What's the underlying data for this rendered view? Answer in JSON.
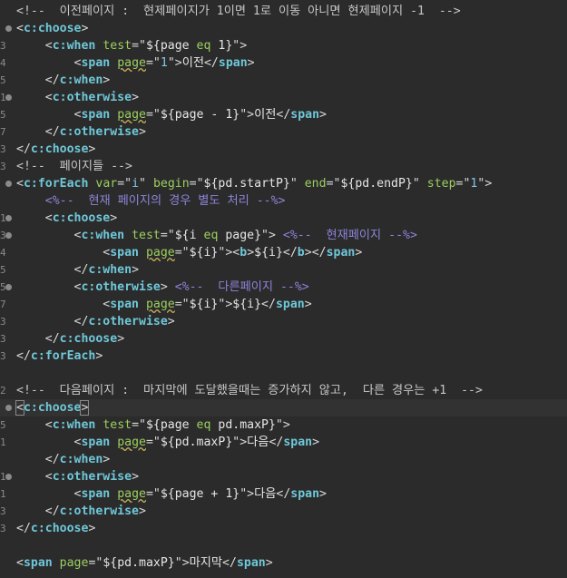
{
  "editor": {
    "lines": [
      {
        "n": "",
        "fold": false,
        "tokens": [
          {
            "c": "cmt",
            "t": "<!--  이전페이지 :  현제페이지가 1이면 1로 이동 아니면 현제페이지 -1  -->"
          }
        ]
      },
      {
        "n": "",
        "fold": true,
        "tokens": [
          {
            "c": "pun",
            "t": "<"
          },
          {
            "c": "tag",
            "t": "c:choose"
          },
          {
            "c": "pun",
            "t": ">"
          }
        ]
      },
      {
        "n": "3",
        "fold": false,
        "tokens": [
          {
            "c": "txt",
            "t": "    "
          },
          {
            "c": "pun",
            "t": "<"
          },
          {
            "c": "tag",
            "t": "c:when"
          },
          {
            "c": "txt",
            "t": " "
          },
          {
            "c": "attr",
            "t": "test"
          },
          {
            "c": "eq",
            "t": "=\""
          },
          {
            "c": "txt",
            "t": "${page "
          },
          {
            "c": "attr",
            "t": "eq"
          },
          {
            "c": "txt",
            "t": " 1}"
          },
          {
            "c": "eq",
            "t": "\""
          },
          {
            "c": "pun",
            "t": ">"
          }
        ]
      },
      {
        "n": "4",
        "fold": false,
        "tokens": [
          {
            "c": "txt",
            "t": "        "
          },
          {
            "c": "pun",
            "t": "<"
          },
          {
            "c": "tag",
            "t": "span"
          },
          {
            "c": "txt",
            "t": " "
          },
          {
            "c": "attr ul",
            "t": "page"
          },
          {
            "c": "eq",
            "t": "=\""
          },
          {
            "c": "str",
            "t": "1"
          },
          {
            "c": "eq",
            "t": "\""
          },
          {
            "c": "pun",
            "t": ">"
          },
          {
            "c": "txt",
            "t": "이전"
          },
          {
            "c": "pun",
            "t": "</"
          },
          {
            "c": "tag",
            "t": "span"
          },
          {
            "c": "pun",
            "t": ">"
          }
        ]
      },
      {
        "n": "5",
        "fold": false,
        "tokens": [
          {
            "c": "txt",
            "t": "    "
          },
          {
            "c": "pun",
            "t": "</"
          },
          {
            "c": "tag",
            "t": "c:when"
          },
          {
            "c": "pun",
            "t": ">"
          }
        ]
      },
      {
        "n": "1",
        "fold": true,
        "tokens": [
          {
            "c": "txt",
            "t": "    "
          },
          {
            "c": "pun",
            "t": "<"
          },
          {
            "c": "tag",
            "t": "c:otherwise"
          },
          {
            "c": "pun",
            "t": ">"
          }
        ]
      },
      {
        "n": "5",
        "fold": false,
        "tokens": [
          {
            "c": "txt",
            "t": "        "
          },
          {
            "c": "pun",
            "t": "<"
          },
          {
            "c": "tag",
            "t": "span"
          },
          {
            "c": "txt",
            "t": " "
          },
          {
            "c": "attr ul",
            "t": "page"
          },
          {
            "c": "eq",
            "t": "=\""
          },
          {
            "c": "txt",
            "t": "${page - 1}"
          },
          {
            "c": "eq",
            "t": "\""
          },
          {
            "c": "pun",
            "t": ">"
          },
          {
            "c": "txt",
            "t": "이전"
          },
          {
            "c": "pun",
            "t": "</"
          },
          {
            "c": "tag",
            "t": "span"
          },
          {
            "c": "pun",
            "t": ">"
          }
        ]
      },
      {
        "n": "7",
        "fold": false,
        "tokens": [
          {
            "c": "txt",
            "t": "    "
          },
          {
            "c": "pun",
            "t": "</"
          },
          {
            "c": "tag",
            "t": "c:otherwise"
          },
          {
            "c": "pun",
            "t": ">"
          }
        ]
      },
      {
        "n": "3",
        "fold": false,
        "tokens": [
          {
            "c": "pun",
            "t": "</"
          },
          {
            "c": "tag",
            "t": "c:choose"
          },
          {
            "c": "pun",
            "t": ">"
          }
        ]
      },
      {
        "n": "3",
        "fold": false,
        "tokens": [
          {
            "c": "cmt",
            "t": "<!--  페이지들 -->"
          }
        ]
      },
      {
        "n": "",
        "fold": true,
        "tokens": [
          {
            "c": "pun",
            "t": "<"
          },
          {
            "c": "tag",
            "t": "c:forEach"
          },
          {
            "c": "txt",
            "t": " "
          },
          {
            "c": "attr",
            "t": "var"
          },
          {
            "c": "eq",
            "t": "=\""
          },
          {
            "c": "str",
            "t": "i"
          },
          {
            "c": "eq",
            "t": "\""
          },
          {
            "c": "txt",
            "t": " "
          },
          {
            "c": "attr",
            "t": "begin"
          },
          {
            "c": "eq",
            "t": "=\""
          },
          {
            "c": "txt",
            "t": "${pd.startP}"
          },
          {
            "c": "eq",
            "t": "\""
          },
          {
            "c": "txt",
            "t": " "
          },
          {
            "c": "attr",
            "t": "end"
          },
          {
            "c": "eq",
            "t": "=\""
          },
          {
            "c": "txt",
            "t": "${pd.endP}"
          },
          {
            "c": "eq",
            "t": "\""
          },
          {
            "c": "txt",
            "t": " "
          },
          {
            "c": "attr",
            "t": "step"
          },
          {
            "c": "eq",
            "t": "=\""
          },
          {
            "c": "str",
            "t": "1"
          },
          {
            "c": "eq",
            "t": "\""
          },
          {
            "c": "pun",
            "t": ">"
          }
        ]
      },
      {
        "n": "",
        "fold": false,
        "tokens": [
          {
            "c": "txt",
            "t": "    "
          },
          {
            "c": "jsp",
            "t": "<%--  현재 페이지의 경우 별도 처리 --%>"
          }
        ]
      },
      {
        "n": "1",
        "fold": true,
        "tokens": [
          {
            "c": "txt",
            "t": "    "
          },
          {
            "c": "pun",
            "t": "<"
          },
          {
            "c": "tag",
            "t": "c:choose"
          },
          {
            "c": "pun",
            "t": ">"
          }
        ]
      },
      {
        "n": "3",
        "fold": true,
        "tokens": [
          {
            "c": "txt",
            "t": "        "
          },
          {
            "c": "pun",
            "t": "<"
          },
          {
            "c": "tag",
            "t": "c:when"
          },
          {
            "c": "txt",
            "t": " "
          },
          {
            "c": "attr",
            "t": "test"
          },
          {
            "c": "eq",
            "t": "=\""
          },
          {
            "c": "txt",
            "t": "${i "
          },
          {
            "c": "attr",
            "t": "eq"
          },
          {
            "c": "txt",
            "t": " page}"
          },
          {
            "c": "eq",
            "t": "\""
          },
          {
            "c": "pun",
            "t": ">"
          },
          {
            "c": "txt",
            "t": " "
          },
          {
            "c": "jsp",
            "t": "<%--  현재페이지 --%>"
          }
        ]
      },
      {
        "n": "4",
        "fold": false,
        "tokens": [
          {
            "c": "txt",
            "t": "            "
          },
          {
            "c": "pun",
            "t": "<"
          },
          {
            "c": "tag",
            "t": "span"
          },
          {
            "c": "txt",
            "t": " "
          },
          {
            "c": "attr ul",
            "t": "page"
          },
          {
            "c": "eq",
            "t": "=\""
          },
          {
            "c": "txt",
            "t": "${i}"
          },
          {
            "c": "eq",
            "t": "\""
          },
          {
            "c": "pun",
            "t": ">"
          },
          {
            "c": "pun",
            "t": "<"
          },
          {
            "c": "tag",
            "t": "b"
          },
          {
            "c": "pun",
            "t": ">"
          },
          {
            "c": "txt",
            "t": "${i}"
          },
          {
            "c": "pun",
            "t": "</"
          },
          {
            "c": "tag",
            "t": "b"
          },
          {
            "c": "pun",
            "t": ">"
          },
          {
            "c": "pun",
            "t": "</"
          },
          {
            "c": "tag",
            "t": "span"
          },
          {
            "c": "pun",
            "t": ">"
          }
        ]
      },
      {
        "n": "5",
        "fold": false,
        "tokens": [
          {
            "c": "txt",
            "t": "        "
          },
          {
            "c": "pun",
            "t": "</"
          },
          {
            "c": "tag",
            "t": "c:when"
          },
          {
            "c": "pun",
            "t": ">"
          }
        ]
      },
      {
        "n": "5",
        "fold": true,
        "tokens": [
          {
            "c": "txt",
            "t": "        "
          },
          {
            "c": "pun",
            "t": "<"
          },
          {
            "c": "tag",
            "t": "c:otherwise"
          },
          {
            "c": "pun",
            "t": ">"
          },
          {
            "c": "txt",
            "t": " "
          },
          {
            "c": "jsp",
            "t": "<%--  다른페이지 --%>"
          }
        ]
      },
      {
        "n": "7",
        "fold": false,
        "tokens": [
          {
            "c": "txt",
            "t": "            "
          },
          {
            "c": "pun",
            "t": "<"
          },
          {
            "c": "tag",
            "t": "span"
          },
          {
            "c": "txt",
            "t": " "
          },
          {
            "c": "attr ul",
            "t": "page"
          },
          {
            "c": "eq",
            "t": "=\""
          },
          {
            "c": "txt",
            "t": "${i}"
          },
          {
            "c": "eq",
            "t": "\""
          },
          {
            "c": "pun",
            "t": ">"
          },
          {
            "c": "txt",
            "t": "${i}"
          },
          {
            "c": "pun",
            "t": "</"
          },
          {
            "c": "tag",
            "t": "span"
          },
          {
            "c": "pun",
            "t": ">"
          }
        ]
      },
      {
        "n": "3",
        "fold": false,
        "tokens": [
          {
            "c": "txt",
            "t": "        "
          },
          {
            "c": "pun",
            "t": "</"
          },
          {
            "c": "tag",
            "t": "c:otherwise"
          },
          {
            "c": "pun",
            "t": ">"
          }
        ]
      },
      {
        "n": "3",
        "fold": false,
        "tokens": [
          {
            "c": "txt",
            "t": "    "
          },
          {
            "c": "pun",
            "t": "</"
          },
          {
            "c": "tag",
            "t": "c:choose"
          },
          {
            "c": "pun",
            "t": ">"
          }
        ]
      },
      {
        "n": "3",
        "fold": false,
        "tokens": [
          {
            "c": "pun",
            "t": "</"
          },
          {
            "c": "tag",
            "t": "c:forEach"
          },
          {
            "c": "pun",
            "t": ">"
          }
        ]
      },
      {
        "n": "",
        "fold": false,
        "tokens": []
      },
      {
        "n": "2",
        "fold": false,
        "tokens": [
          {
            "c": "cmt",
            "t": "<!--  다음페이지 :  마지막에 도달했을때는 증가하지 않고,  다른 경우는 +1  -->"
          }
        ]
      },
      {
        "n": "",
        "fold": true,
        "active": true,
        "tokens": [
          {
            "c": "pun sel",
            "t": "<"
          },
          {
            "c": "tag",
            "t": "c:choose"
          },
          {
            "c": "pun sel",
            "t": ">"
          },
          {
            "c": "cursor",
            "t": ""
          }
        ]
      },
      {
        "n": "5",
        "fold": false,
        "tokens": [
          {
            "c": "txt",
            "t": "    "
          },
          {
            "c": "pun",
            "t": "<"
          },
          {
            "c": "tag",
            "t": "c:when"
          },
          {
            "c": "txt",
            "t": " "
          },
          {
            "c": "attr",
            "t": "test"
          },
          {
            "c": "eq",
            "t": "=\""
          },
          {
            "c": "txt",
            "t": "${page "
          },
          {
            "c": "attr",
            "t": "eq"
          },
          {
            "c": "txt",
            "t": " pd.maxP}"
          },
          {
            "c": "eq",
            "t": "\""
          },
          {
            "c": "pun",
            "t": ">"
          }
        ]
      },
      {
        "n": "1",
        "fold": false,
        "tokens": [
          {
            "c": "txt",
            "t": "        "
          },
          {
            "c": "pun",
            "t": "<"
          },
          {
            "c": "tag",
            "t": "span"
          },
          {
            "c": "txt",
            "t": " "
          },
          {
            "c": "attr ul",
            "t": "page"
          },
          {
            "c": "eq",
            "t": "=\""
          },
          {
            "c": "txt",
            "t": "${pd.maxP}"
          },
          {
            "c": "eq",
            "t": "\""
          },
          {
            "c": "pun",
            "t": ">"
          },
          {
            "c": "txt",
            "t": "다음"
          },
          {
            "c": "pun",
            "t": "</"
          },
          {
            "c": "tag",
            "t": "span"
          },
          {
            "c": "pun",
            "t": ">"
          }
        ]
      },
      {
        "n": "",
        "fold": false,
        "tokens": [
          {
            "c": "txt",
            "t": "    "
          },
          {
            "c": "pun",
            "t": "</"
          },
          {
            "c": "tag",
            "t": "c:when"
          },
          {
            "c": "pun",
            "t": ">"
          }
        ]
      },
      {
        "n": "1",
        "fold": true,
        "tokens": [
          {
            "c": "txt",
            "t": "    "
          },
          {
            "c": "pun",
            "t": "<"
          },
          {
            "c": "tag",
            "t": "c:otherwise"
          },
          {
            "c": "pun",
            "t": ">"
          }
        ]
      },
      {
        "n": "1",
        "fold": false,
        "tokens": [
          {
            "c": "txt",
            "t": "        "
          },
          {
            "c": "pun",
            "t": "<"
          },
          {
            "c": "tag",
            "t": "span"
          },
          {
            "c": "txt",
            "t": " "
          },
          {
            "c": "attr ul",
            "t": "page"
          },
          {
            "c": "eq",
            "t": "=\""
          },
          {
            "c": "txt",
            "t": "${page + 1}"
          },
          {
            "c": "eq",
            "t": "\""
          },
          {
            "c": "pun",
            "t": ">"
          },
          {
            "c": "txt",
            "t": "다음"
          },
          {
            "c": "pun",
            "t": "</"
          },
          {
            "c": "tag",
            "t": "span"
          },
          {
            "c": "pun",
            "t": ">"
          }
        ]
      },
      {
        "n": "3",
        "fold": false,
        "tokens": [
          {
            "c": "txt",
            "t": "    "
          },
          {
            "c": "pun",
            "t": "</"
          },
          {
            "c": "tag",
            "t": "c:otherwise"
          },
          {
            "c": "pun",
            "t": ">"
          }
        ]
      },
      {
        "n": "3",
        "fold": false,
        "tokens": [
          {
            "c": "pun",
            "t": "</"
          },
          {
            "c": "tag",
            "t": "c:choose"
          },
          {
            "c": "pun",
            "t": ">"
          }
        ]
      },
      {
        "n": "",
        "fold": false,
        "tokens": []
      },
      {
        "n": "",
        "fold": false,
        "tokens": [
          {
            "c": "pun",
            "t": "<"
          },
          {
            "c": "tag",
            "t": "span"
          },
          {
            "c": "txt",
            "t": " "
          },
          {
            "c": "attr",
            "t": "page"
          },
          {
            "c": "eq",
            "t": "=\""
          },
          {
            "c": "txt",
            "t": "${pd.maxP}"
          },
          {
            "c": "eq",
            "t": "\""
          },
          {
            "c": "pun",
            "t": ">"
          },
          {
            "c": "txt",
            "t": "마지막"
          },
          {
            "c": "pun",
            "t": "</"
          },
          {
            "c": "tag",
            "t": "span"
          },
          {
            "c": "pun",
            "t": ">"
          }
        ]
      }
    ]
  }
}
